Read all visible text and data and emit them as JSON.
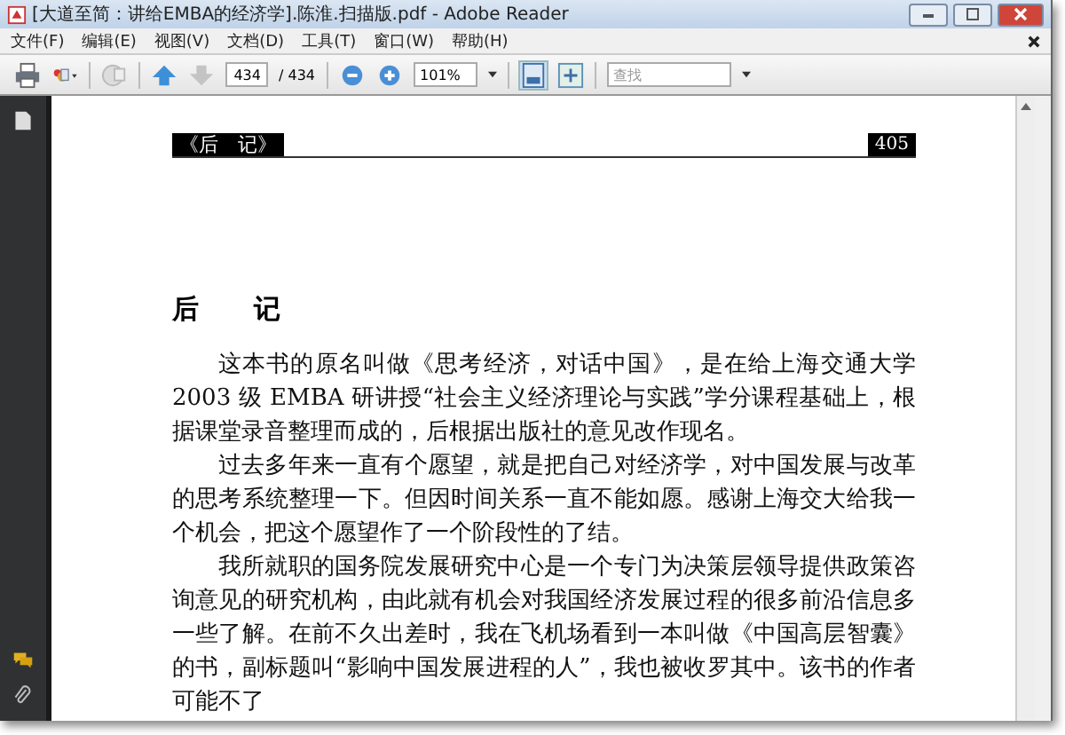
{
  "window": {
    "title": "[大道至简：讲给EMBA的经济学].陈淮.扫描版.pdf - Adobe Reader"
  },
  "menu": [
    "文件(F)",
    "编辑(E)",
    "视图(V)",
    "文档(D)",
    "工具(T)",
    "窗口(W)",
    "帮助(H)"
  ],
  "toolbar": {
    "page_field": "434",
    "page_total": "/ 434",
    "zoom_field": "101%",
    "search": {
      "placeholder": "查找"
    }
  },
  "page": {
    "running_head": "《后　记》",
    "page_number": "405",
    "heading": "后　记",
    "paragraphs": [
      "这本书的原名叫做《思考经济，对话中国》，是在给上海交通大学 2003 级 EMBA 研讲授“社会主义经济理论与实践”学分课程基础上，根据课堂录音整理而成的，后根据出版社的意见改作现名。",
      "过去多年来一直有个愿望，就是把自己对经济学，对中国发展与改革的思考系统整理一下。但因时间关系一直不能如愿。感谢上海交大给我一个机会，把这个愿望作了一个阶段性的了结。",
      "我所就职的国务院发展研究中心是一个专门为决策层领导提供政策咨询意见的研究机构，由此就有机会对我国经济发展过程的很多前沿信息多一些了解。在前不久出差时，我在飞机场看到一本叫做《中国高层智囊》的书，副标题叫“影响中国发展进程的人”，我也被收罗其中。该书的作者可能不了"
    ]
  }
}
